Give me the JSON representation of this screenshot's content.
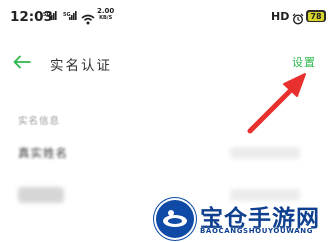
{
  "status_bar": {
    "time": "12:03",
    "signal_1": "5G",
    "signal_2": "5G",
    "wifi_icon": "wifi-icon",
    "net_speed_value": "2.00",
    "net_speed_unit": "KB/S",
    "hd_label": "HD",
    "alarm_icon": "alarm-icon",
    "battery_level": "78"
  },
  "app_bar": {
    "back_icon": "arrow-left-icon",
    "title": "实名认证",
    "settings_label": "设置"
  },
  "section": {
    "header": "实名信息"
  },
  "rows": [
    {
      "label": "真实姓名"
    }
  ],
  "watermark": {
    "main": "宝仓手游网",
    "sub": "BAOCANGSHOUYOUWANG"
  },
  "colors": {
    "accent": "#2db84c",
    "annotation_arrow": "#e8302f",
    "watermark": "#0f3f8f"
  }
}
